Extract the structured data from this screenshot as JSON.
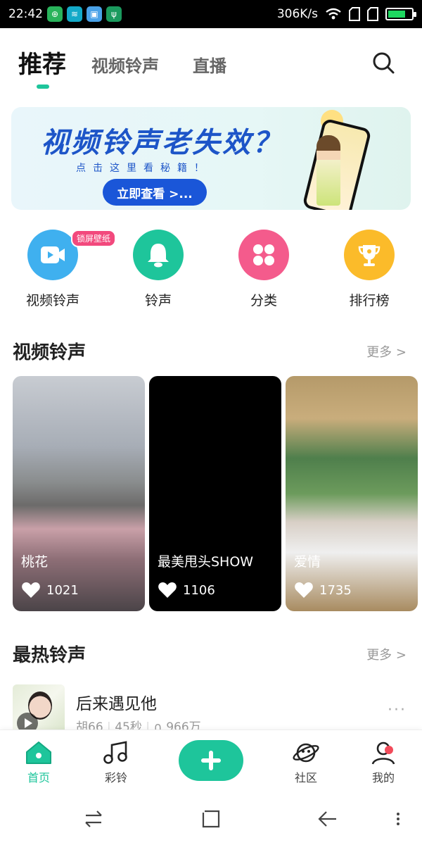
{
  "status_bar": {
    "time": "22:42",
    "net_speed": "306K/s",
    "battery_level": 0.75,
    "icons": [
      "signal-app-icon",
      "wifi-icon",
      "sim-icon",
      "sim-icon",
      "battery-icon"
    ]
  },
  "top_tabs": {
    "active": "推荐",
    "items": [
      "视频铃声",
      "直播"
    ]
  },
  "banner": {
    "title": "视频铃声老失效？",
    "subtitle": "点击这里看秘籍！",
    "button": "立即查看 >..."
  },
  "quick_entries": [
    {
      "label": "视频铃声",
      "color": "#3fb0ef",
      "icon": "video-icon",
      "badge": "锁屏壁纸"
    },
    {
      "label": "铃声",
      "color": "#1ec59b",
      "icon": "bell-icon"
    },
    {
      "label": "分类",
      "color": "#f45b8c",
      "icon": "grid-icon"
    },
    {
      "label": "排行榜",
      "color": "#fbbb2a",
      "icon": "trophy-icon"
    }
  ],
  "video_section": {
    "title": "视频铃声",
    "more": "更多 >",
    "cards": [
      {
        "title": "桃花",
        "likes": "1021"
      },
      {
        "title": "最美甩头SHOW",
        "likes": "1106"
      },
      {
        "title": "爱情",
        "likes": "1735"
      }
    ]
  },
  "hot_section": {
    "title": "最热铃声",
    "more": "更多 >",
    "songs": [
      {
        "name": "后来遇见他",
        "artist": "胡66",
        "duration": "45秒",
        "plays": "966万"
      }
    ]
  },
  "bottom_nav": {
    "home": "首页",
    "ringtone": "彩铃",
    "community": "社区",
    "mine": "我的"
  },
  "colors": {
    "accent": "#1ec59b",
    "banner_blue": "#1a56d8"
  }
}
